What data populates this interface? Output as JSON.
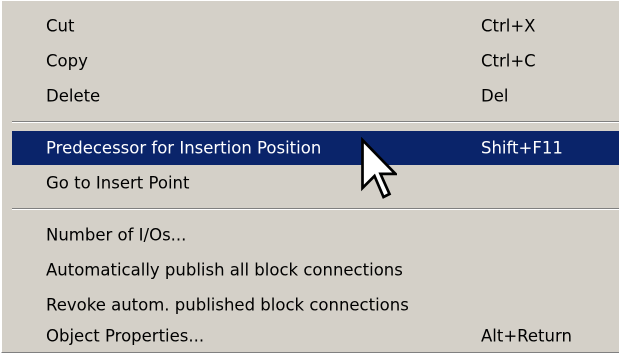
{
  "context_menu": {
    "group1": [
      {
        "label": "Cut",
        "shortcut": "Ctrl+X"
      },
      {
        "label": "Copy",
        "shortcut": "Ctrl+C"
      },
      {
        "label": "Delete",
        "shortcut": "Del"
      }
    ],
    "group2": [
      {
        "label": "Predecessor for Insertion Position",
        "shortcut": "Shift+F11"
      },
      {
        "label": "Go to Insert Point",
        "shortcut": ""
      }
    ],
    "group3": [
      {
        "label": "Number of I/Os...",
        "shortcut": ""
      },
      {
        "label": "Automatically publish all block connections",
        "shortcut": ""
      },
      {
        "label": "Revoke autom. published block connections",
        "shortcut": ""
      },
      {
        "label": "Object Properties...",
        "shortcut": "Alt+Return"
      }
    ]
  },
  "highlight_color": "#0a246a",
  "menu_background": "#d4d0c8",
  "cursor_icon": "arrow-cursor-icon"
}
